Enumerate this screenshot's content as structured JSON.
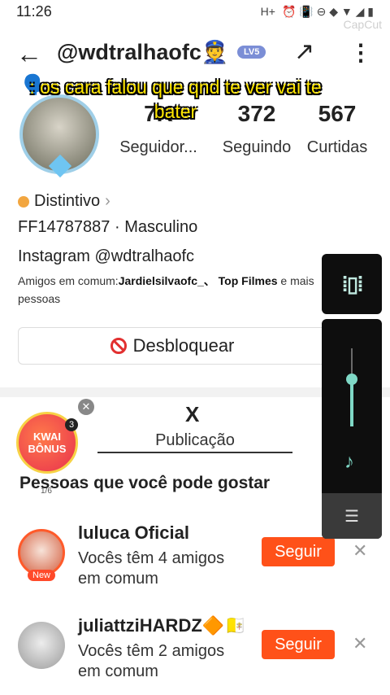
{
  "status_bar": {
    "time": "11:26",
    "icons": "⏰ 📳 ⊖ ◆ ▼ ◢ ▮",
    "net_label": "H+"
  },
  "watermark": "CapCut",
  "header": {
    "back_icon": "←",
    "username": "@wdtralhaofc👮",
    "level_label": "LV5",
    "share_icon": "↗",
    "more_icon": "⋮"
  },
  "caption": {
    "emoji": "🗣️",
    "text": ": os cara falou que qnd te ver vai te bater"
  },
  "stats": [
    {
      "value": "7K",
      "label": "Seguidor..."
    },
    {
      "value": "372",
      "label": "Seguindo"
    },
    {
      "value": "567",
      "label": "Curtidas"
    }
  ],
  "profile": {
    "badge_label": "Distintivo",
    "badge_chevron": "›",
    "id_line": "FF14787887 · Masculino",
    "instagram_line": "Instagram @wdtralhaofc",
    "mutual_prefix": "Amigos em comum:",
    "mutual_names": "Jardielsilvaofc_、 Top Filmes",
    "mutual_suffix": " e mais pessoas"
  },
  "unblock_button": {
    "label": "Desbloquear"
  },
  "tabs": {
    "active_mark": "X",
    "active_label": "Publicação"
  },
  "kwai_bonus": {
    "label_top": "KWAI",
    "label_bottom": "BÔNUS",
    "count": "3",
    "close": "✕",
    "progress": "1/6"
  },
  "section_title": "Pessoas que você pode gostar",
  "suggestions": [
    {
      "name": "luluca Oficial",
      "subtitle": "Vocês têm 4 amigos em comum",
      "follow_label": "Seguir",
      "badge": "New",
      "dismiss": "✕"
    },
    {
      "name": "juliattziHARDZ🔶🇻🇦",
      "subtitle": "Vocês têm 2 amigos em comum",
      "follow_label": "Seguir",
      "dismiss": "✕"
    }
  ],
  "volume_panel": {
    "vibrate_icon": "▯",
    "music_icon": "♪",
    "settings_icon": "☰",
    "level_fraction": 0.6
  },
  "colors": {
    "accent": "#ff5119",
    "caption_yellow": "#ffe600",
    "volume_teal": "#7fd8c6",
    "block_red": "#e23030"
  }
}
